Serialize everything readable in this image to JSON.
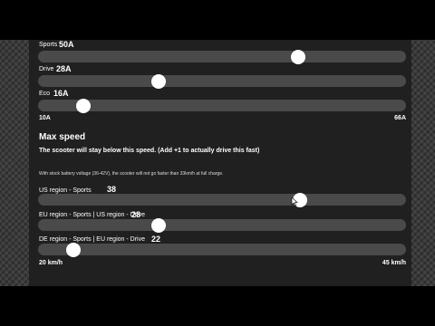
{
  "power": {
    "sliders": [
      {
        "label": "Sports",
        "value_text": "50A",
        "value": 50
      },
      {
        "label": "Drive",
        "value_text": "28A",
        "value": 28
      },
      {
        "label": "Eco",
        "value_text": "16A",
        "value": 16
      }
    ],
    "min_label": "10A",
    "max_label": "66A",
    "min": 10,
    "max": 66
  },
  "speed": {
    "title": "Max speed",
    "subtitle": "The scooter will stay below this speed. (Add +1 to actually drive this fast)",
    "note": "With stock battery voltage (36-42V), the scooter will not go faster than 33km/h at full charge.",
    "sliders": [
      {
        "label": "US region - Sports",
        "value_text": "38",
        "value": 38
      },
      {
        "label": "EU region - Sports | US region - Drive",
        "value_text": "28",
        "value": 28
      },
      {
        "label": "DE region - Sports | EU region - Drive",
        "value_text": "22",
        "value": 22
      }
    ],
    "min_label": "20 km/h",
    "max_label": "45 km/h",
    "min": 20,
    "max": 45
  }
}
